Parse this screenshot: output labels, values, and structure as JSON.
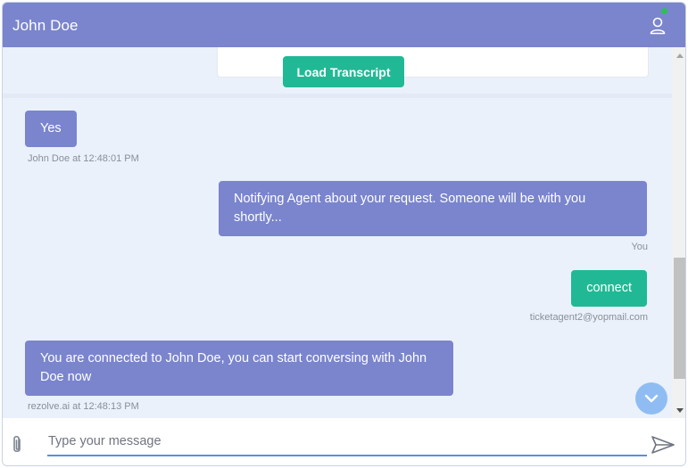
{
  "header": {
    "title": "John Doe",
    "user_icon": "user-icon",
    "status_color": "#2fbf57"
  },
  "history": {
    "load_transcript_label": "Load Transcript"
  },
  "messages": [
    {
      "text": "Yes",
      "meta": "John Doe at 12:48:01 PM",
      "side": "left",
      "color": "#7a85cd"
    },
    {
      "text": "Notifying Agent about your request. Someone will be with you shortly...",
      "meta": "You",
      "side": "right",
      "color": "#7a85cd"
    },
    {
      "text": "connect",
      "meta": "ticketagent2@yopmail.com",
      "side": "right",
      "color": "#21b995"
    },
    {
      "text": "You are connected to John Doe, you can start conversing with John Doe now",
      "meta": "rezolve.ai at 12:48:13 PM",
      "side": "left",
      "color": "#7a85cd"
    }
  ],
  "composer": {
    "placeholder": "Type your message",
    "attach_icon": "paperclip-icon",
    "send_icon": "send-icon"
  },
  "colors": {
    "header": "#7a85cd",
    "accent": "#21b995",
    "input_underline": "#5b8fd9"
  }
}
